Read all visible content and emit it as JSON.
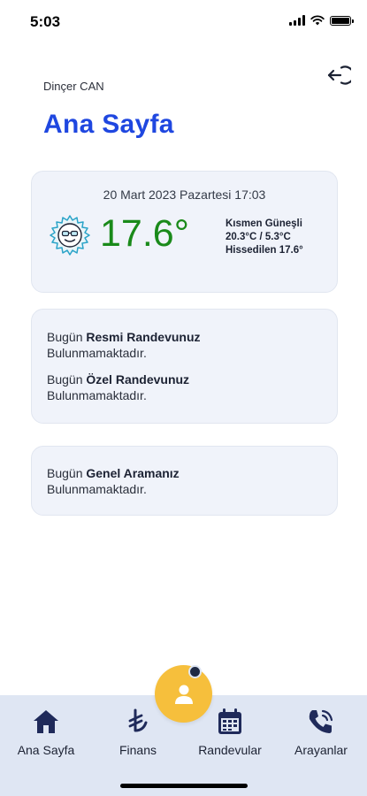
{
  "status": {
    "time": "5:03"
  },
  "user": {
    "name": "Dinçer CAN"
  },
  "page": {
    "title": "Ana Sayfa"
  },
  "weather": {
    "datetime": "20 Mart 2023 Pazartesi 17:03",
    "temperature": "17.6°",
    "condition": "Kısmen Güneşli",
    "range": "20.3°C / 5.3°C",
    "feels_like": "Hissedilen 17.6°",
    "icon": "partly-sunny-icon"
  },
  "appointments": {
    "official_prefix": "Bugün",
    "official_bold": "Resmi Randevunuz",
    "official_status": "Bulunmamaktadır.",
    "private_prefix": "Bugün",
    "private_bold": "Özel Randevunuz",
    "private_status": "Bulunmamaktadır."
  },
  "calls": {
    "prefix": "Bugün",
    "bold": "Genel Aramanız",
    "status": "Bulunmamaktadır."
  },
  "tabs": [
    {
      "label": "Ana Sayfa",
      "icon": "home-icon"
    },
    {
      "label": "Finans",
      "icon": "lira-icon"
    },
    {
      "label": "Randevular",
      "icon": "calendar-icon"
    },
    {
      "label": "Arayanlar",
      "icon": "phone-icon"
    }
  ],
  "colors": {
    "accent": "#1f47e0",
    "temperature": "#1a8a1a",
    "fab": "#f6bf3c",
    "tab_icon": "#1f2a5a",
    "tab_bar": "#dfe6f3",
    "card": "#f0f3fa"
  }
}
